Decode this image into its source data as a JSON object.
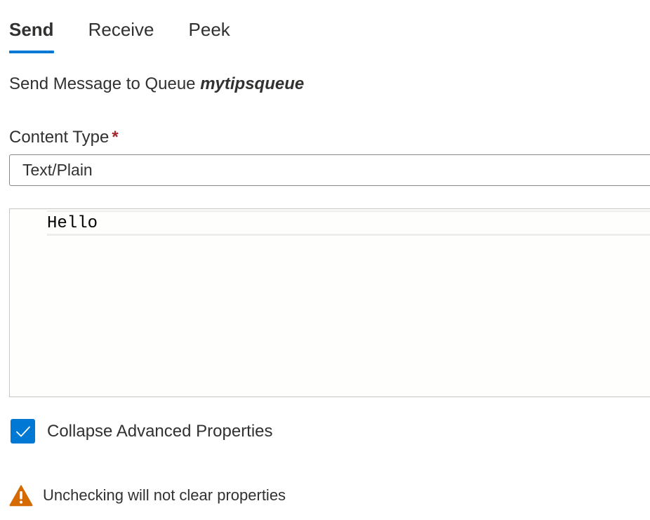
{
  "tabs": [
    {
      "label": "Send",
      "active": true
    },
    {
      "label": "Receive",
      "active": false
    },
    {
      "label": "Peek",
      "active": false
    }
  ],
  "heading": {
    "prefix": "Send Message to Queue ",
    "queue_name": "mytipsqueue"
  },
  "content_type": {
    "label": "Content Type",
    "required_marker": "*",
    "value": "Text/Plain"
  },
  "editor": {
    "value": "Hello"
  },
  "collapse_advanced": {
    "label": "Collapse Advanced Properties",
    "checked": true,
    "icon": "checkmark-icon"
  },
  "warning": {
    "icon": "warning-icon",
    "text": "Unchecking will not clear properties"
  },
  "colors": {
    "accent": "#0078d4",
    "required": "#a4262c",
    "warning": "#d46a00",
    "text": "#323130"
  }
}
